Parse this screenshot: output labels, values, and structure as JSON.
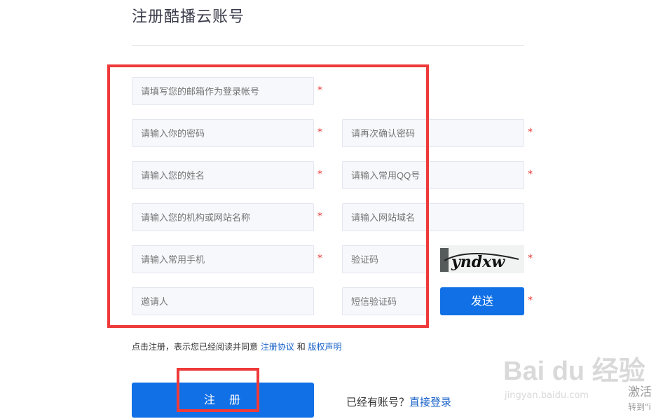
{
  "header": {
    "title": "注册酷播云账号"
  },
  "form": {
    "email_placeholder": "请填写您的邮箱作为登录帐号",
    "password_placeholder": "请输入你的密码",
    "confirm_password_placeholder": "请再次确认密码",
    "name_placeholder": "请输入您的姓名",
    "qq_placeholder": "请输入常用QQ号",
    "org_placeholder": "请输入您的机构或网站名称",
    "domain_placeholder": "请输入网站域名",
    "phone_placeholder": "请输入常用手机",
    "captcha_placeholder": "验证码",
    "inviter_placeholder": "邀请人",
    "sms_code_placeholder": "短信验证码",
    "required_mark": "*",
    "captcha_text": "yndxw",
    "send_label": "发送"
  },
  "agreement": {
    "prefix": "点击注册，表示您已经阅读并同意",
    "terms_link": "注册协议",
    "and": "和",
    "copyright_link": "版权声明"
  },
  "actions": {
    "register_label": "注　册",
    "login_prompt": "已经有账号？",
    "login_link": "直接登录"
  },
  "watermark": {
    "logo_text": "Bai du 经验",
    "url": "jingyan.baidu.com",
    "activate_line1": "激活",
    "activate_line2": "转到\"i"
  },
  "colors": {
    "accent": "#1170e6",
    "required": "#e63a3a",
    "annotation": "#ee3a3a"
  }
}
